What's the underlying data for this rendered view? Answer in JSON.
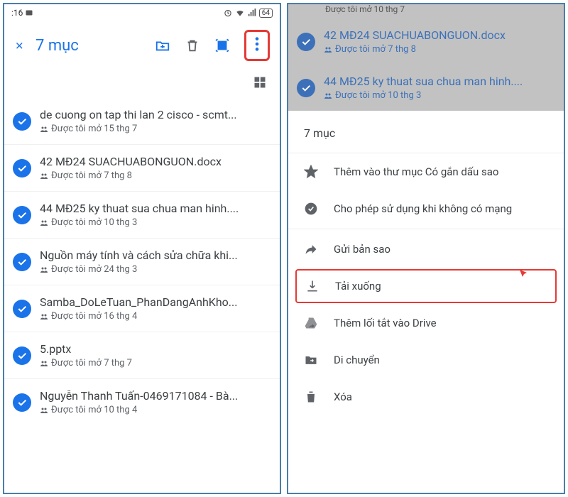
{
  "status": {
    "time": ":16",
    "battery": "64"
  },
  "left": {
    "title": "7 mục",
    "files": [
      {
        "name": "de cuong on tap thi lan 2 cisco - scmt...",
        "meta": "Được tôi mở 15 thg 7"
      },
      {
        "name": "42 MĐ24 SUACHUABONGUON.docx",
        "meta": "Được tôi mở 7 thg 8"
      },
      {
        "name": "44 MĐ25 ky thuat sua chua man hinh....",
        "meta": "Được tôi mở 10 thg 3"
      },
      {
        "name": "Nguồn máy tính và cách sửa chữa khi...",
        "meta": "Được tôi mở 24 thg 3"
      },
      {
        "name": "Samba_DoLeTuan_PhanDangAnhKho...",
        "meta": "Được tôi mở 16 thg 4"
      },
      {
        "name": "5.pptx",
        "meta": "Được tôi mở 7 thg 7"
      },
      {
        "name": "Nguyễn Thanh Tuấn-0469171084 - Bà...",
        "meta": "Được tôi mở 10 thg 4"
      }
    ]
  },
  "right": {
    "dim_sub": "Được tôi mở 10 thg 7",
    "dimmed_files": [
      {
        "name": "42 MĐ24 SUACHUABONGUON.docx",
        "meta": "Được tôi mở 7 thg 8"
      },
      {
        "name": "44 MĐ25 ky thuat sua chua man hinh....",
        "meta": "Được tôi mở 10 thg 3"
      }
    ],
    "sheet_title": "7 mục",
    "menu": {
      "star": "Thêm vào thư mục Có gắn dấu sao",
      "offline": "Cho phép sử dụng khi không có mạng",
      "send": "Gửi bản sao",
      "download": "Tải xuống",
      "shortcut": "Thêm lối tắt vào Drive",
      "move": "Di chuyển",
      "delete": "Xóa"
    }
  }
}
